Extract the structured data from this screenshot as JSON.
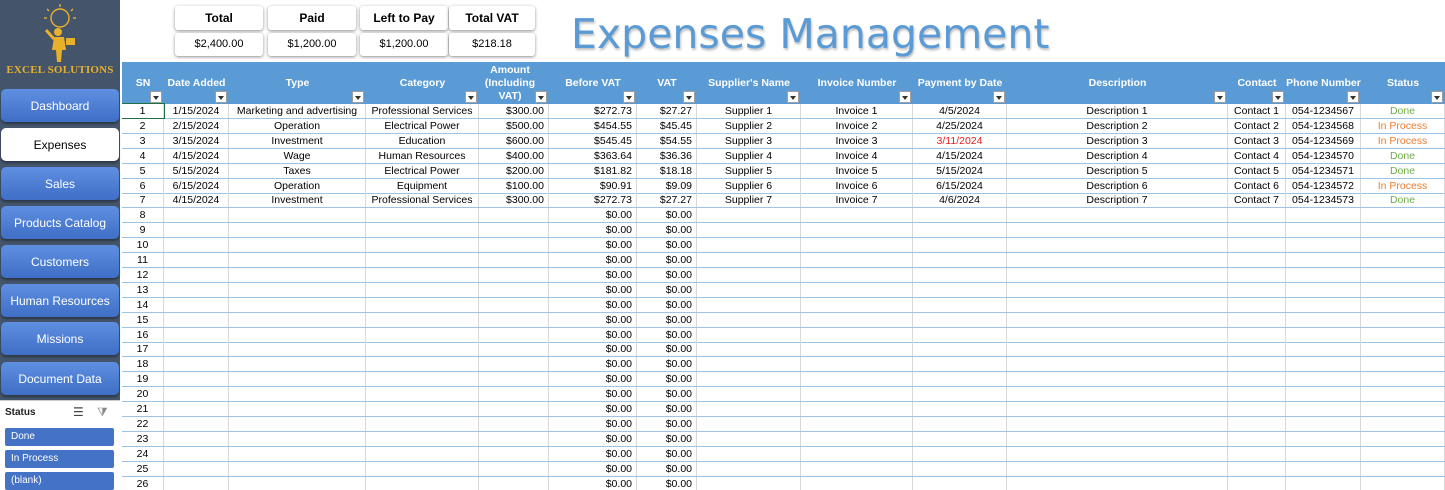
{
  "sidebar": {
    "logo_text": "EXCEL SOLUTIONS",
    "nav": [
      {
        "label": "Dashboard",
        "active": false
      },
      {
        "label": "Expenses",
        "active": true
      },
      {
        "label": "Sales",
        "active": false
      },
      {
        "label": "Products Catalog",
        "active": false
      },
      {
        "label": "Customers",
        "active": false
      },
      {
        "label": "Human Resources",
        "active": false
      },
      {
        "label": "Missions",
        "active": false
      },
      {
        "label": "Document Data",
        "active": false
      }
    ]
  },
  "slicer": {
    "title": "Status",
    "items": [
      "Done",
      "In Process",
      "(blank)"
    ]
  },
  "summary": {
    "total_label": "Total",
    "total_value": "$2,400.00",
    "paid_label": "Paid",
    "paid_value": "$1,200.00",
    "left_label": "Left to Pay",
    "left_value": "$1,200.00",
    "vat_label": "Total VAT",
    "vat_value": "$218.18"
  },
  "page_title": "Expenses Management",
  "table": {
    "columns": [
      "SN",
      "Date Added",
      "Type",
      "Category",
      "Amount (Including VAT)",
      "Before VAT",
      "VAT",
      "Supplier's Name",
      "Invoice Number",
      "Payment by Date",
      "Description",
      "Contact",
      "Phone Number",
      "Status"
    ],
    "rows": [
      [
        "1",
        "1/15/2024",
        "Marketing and advertising",
        "Professional Services",
        "$300.00",
        "$272.73",
        "$27.27",
        "Supplier 1",
        "Invoice 1",
        "4/5/2024",
        "Description 1",
        "Contact 1",
        "054-1234567",
        "Done"
      ],
      [
        "2",
        "2/15/2024",
        "Operation",
        "Electrical Power",
        "$500.00",
        "$454.55",
        "$45.45",
        "Supplier 2",
        "Invoice 2",
        "4/25/2024",
        "Description 2",
        "Contact 2",
        "054-1234568",
        "In Process"
      ],
      [
        "3",
        "3/15/2024",
        "Investment",
        "Education",
        "$600.00",
        "$545.45",
        "$54.55",
        "Supplier 3",
        "Invoice 3",
        "3/11/2024",
        "Description 3",
        "Contact 3",
        "054-1234569",
        "In Process"
      ],
      [
        "4",
        "4/15/2024",
        "Wage",
        "Human Resources",
        "$400.00",
        "$363.64",
        "$36.36",
        "Supplier 4",
        "Invoice 4",
        "4/15/2024",
        "Description 4",
        "Contact 4",
        "054-1234570",
        "Done"
      ],
      [
        "5",
        "5/15/2024",
        "Taxes",
        "Electrical Power",
        "$200.00",
        "$181.82",
        "$18.18",
        "Supplier 5",
        "Invoice 5",
        "5/15/2024",
        "Description 5",
        "Contact 5",
        "054-1234571",
        "Done"
      ],
      [
        "6",
        "6/15/2024",
        "Operation",
        "Equipment",
        "$100.00",
        "$90.91",
        "$9.09",
        "Supplier 6",
        "Invoice 6",
        "6/15/2024",
        "Description 6",
        "Contact 6",
        "054-1234572",
        "In Process"
      ],
      [
        "7",
        "4/15/2024",
        "Investment",
        "Professional Services",
        "$300.00",
        "$272.73",
        "$27.27",
        "Supplier 7",
        "Invoice 7",
        "4/6/2024",
        "Description 7",
        "Contact 7",
        "054-1234573",
        "Done"
      ],
      [
        "8",
        "",
        "",
        "",
        "",
        "$0.00",
        "$0.00",
        "",
        "",
        "",
        "",
        "",
        "",
        ""
      ],
      [
        "9",
        "",
        "",
        "",
        "",
        "$0.00",
        "$0.00",
        "",
        "",
        "",
        "",
        "",
        "",
        ""
      ],
      [
        "10",
        "",
        "",
        "",
        "",
        "$0.00",
        "$0.00",
        "",
        "",
        "",
        "",
        "",
        "",
        ""
      ],
      [
        "11",
        "",
        "",
        "",
        "",
        "$0.00",
        "$0.00",
        "",
        "",
        "",
        "",
        "",
        "",
        ""
      ],
      [
        "12",
        "",
        "",
        "",
        "",
        "$0.00",
        "$0.00",
        "",
        "",
        "",
        "",
        "",
        "",
        ""
      ],
      [
        "13",
        "",
        "",
        "",
        "",
        "$0.00",
        "$0.00",
        "",
        "",
        "",
        "",
        "",
        "",
        ""
      ],
      [
        "14",
        "",
        "",
        "",
        "",
        "$0.00",
        "$0.00",
        "",
        "",
        "",
        "",
        "",
        "",
        ""
      ],
      [
        "15",
        "",
        "",
        "",
        "",
        "$0.00",
        "$0.00",
        "",
        "",
        "",
        "",
        "",
        "",
        ""
      ],
      [
        "16",
        "",
        "",
        "",
        "",
        "$0.00",
        "$0.00",
        "",
        "",
        "",
        "",
        "",
        "",
        ""
      ],
      [
        "17",
        "",
        "",
        "",
        "",
        "$0.00",
        "$0.00",
        "",
        "",
        "",
        "",
        "",
        "",
        ""
      ],
      [
        "18",
        "",
        "",
        "",
        "",
        "$0.00",
        "$0.00",
        "",
        "",
        "",
        "",
        "",
        "",
        ""
      ],
      [
        "19",
        "",
        "",
        "",
        "",
        "$0.00",
        "$0.00",
        "",
        "",
        "",
        "",
        "",
        "",
        ""
      ],
      [
        "20",
        "",
        "",
        "",
        "",
        "$0.00",
        "$0.00",
        "",
        "",
        "",
        "",
        "",
        "",
        ""
      ],
      [
        "21",
        "",
        "",
        "",
        "",
        "$0.00",
        "$0.00",
        "",
        "",
        "",
        "",
        "",
        "",
        ""
      ],
      [
        "22",
        "",
        "",
        "",
        "",
        "$0.00",
        "$0.00",
        "",
        "",
        "",
        "",
        "",
        "",
        ""
      ],
      [
        "23",
        "",
        "",
        "",
        "",
        "$0.00",
        "$0.00",
        "",
        "",
        "",
        "",
        "",
        "",
        ""
      ],
      [
        "24",
        "",
        "",
        "",
        "",
        "$0.00",
        "$0.00",
        "",
        "",
        "",
        "",
        "",
        "",
        ""
      ],
      [
        "25",
        "",
        "",
        "",
        "",
        "$0.00",
        "$0.00",
        "",
        "",
        "",
        "",
        "",
        "",
        ""
      ],
      [
        "26",
        "",
        "",
        "",
        "",
        "$0.00",
        "$0.00",
        "",
        "",
        "",
        "",
        "",
        "",
        ""
      ]
    ],
    "overdue_rows": [
      3
    ]
  },
  "colors": {
    "header": "#5b9bd5",
    "done": "#70ad47",
    "in_process": "#ed7d31",
    "overdue": "#e02020",
    "nav": "#4472c4",
    "sidebar": "#44546a"
  },
  "icons": [
    "multi-select-icon",
    "clear-filter-icon",
    "filter-dropdown-icon"
  ]
}
